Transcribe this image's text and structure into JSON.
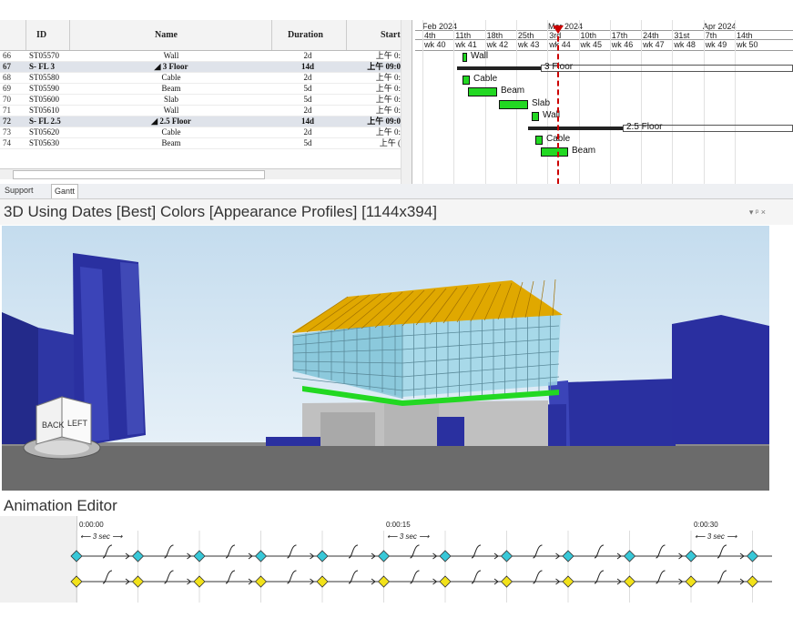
{
  "grid": {
    "headers": {
      "id": "ID",
      "name": "Name",
      "duration": "Duration",
      "start": "Start"
    },
    "rows": [
      {
        "num": "66",
        "id": "ST05570",
        "name": "Wall",
        "duration": "2d",
        "start": "上午 0:",
        "summary": false
      },
      {
        "num": "67",
        "id": "S- FL 3",
        "name": "◢ 3 Floor",
        "duration": "14d",
        "start": "上午 09:0",
        "summary": true
      },
      {
        "num": "68",
        "id": "ST05580",
        "name": "Cable",
        "duration": "2d",
        "start": "上午 0:",
        "summary": false
      },
      {
        "num": "69",
        "id": "ST05590",
        "name": "Beam",
        "duration": "5d",
        "start": "上午 0:",
        "summary": false
      },
      {
        "num": "70",
        "id": "ST05600",
        "name": "Slab",
        "duration": "5d",
        "start": "上午 0:",
        "summary": false
      },
      {
        "num": "71",
        "id": "ST05610",
        "name": "Wall",
        "duration": "2d",
        "start": "上午 0:",
        "summary": false
      },
      {
        "num": "72",
        "id": "S- FL 2.5",
        "name": "◢ 2.5 Floor",
        "duration": "14d",
        "start": "上午 09:0",
        "summary": true
      },
      {
        "num": "73",
        "id": "ST05620",
        "name": "Cable",
        "duration": "2d",
        "start": "上午 0:",
        "summary": false
      },
      {
        "num": "74",
        "id": "ST05630",
        "name": "Beam",
        "duration": "5d",
        "start": "上午 (",
        "summary": false
      }
    ]
  },
  "gantt": {
    "months": [
      "Feb 2024",
      "Mar 2024",
      "Apr 2024"
    ],
    "days": [
      "4th",
      "11th",
      "18th",
      "25th",
      "3rd",
      "10th",
      "17th",
      "24th",
      "31st",
      "7th",
      "14th"
    ],
    "weeks": [
      "wk 40",
      "wk 41",
      "wk 42",
      "wk 43",
      "wk 44",
      "wk 45",
      "wk 46",
      "wk 47",
      "wk 48",
      "wk 49",
      "wk 50"
    ],
    "bars": [
      {
        "label": "Wall",
        "type": "task"
      },
      {
        "label": "3 Floor",
        "type": "summary"
      },
      {
        "label": "Cable",
        "type": "task"
      },
      {
        "label": "Beam",
        "type": "task"
      },
      {
        "label": "Slab",
        "type": "task"
      },
      {
        "label": "Wall",
        "type": "task"
      },
      {
        "label": "2.5 Floor",
        "type": "summary"
      },
      {
        "label": "Cable",
        "type": "task"
      },
      {
        "label": "Beam",
        "type": "task"
      }
    ]
  },
  "tabs": [
    "Support",
    "Gantt"
  ],
  "view": {
    "title": "3D Using Dates [Best] Colors [Appearance Profiles]  [1144x394]",
    "controls": "▾ ᵖ ×",
    "cube_faces": [
      "BACK",
      "LEFT"
    ]
  },
  "animation": {
    "title": "Animation Editor",
    "times": [
      "0:00:00",
      "0:00:15",
      "0:00:30"
    ],
    "durations": [
      "3 sec",
      "3 sec",
      "3 sec"
    ]
  },
  "colors": {
    "task_bar": "#22d822",
    "summary_bar": "#222222",
    "today_line": "#cc0000",
    "building_blue": "#2a2e9a",
    "roof_yellow": "#e0a800",
    "glass": "#9fd6e6",
    "sky": "#cfe3f2",
    "ground": "#6b6b6b",
    "key_cyan": "#38c8d8",
    "key_yellow": "#f2e21a"
  }
}
